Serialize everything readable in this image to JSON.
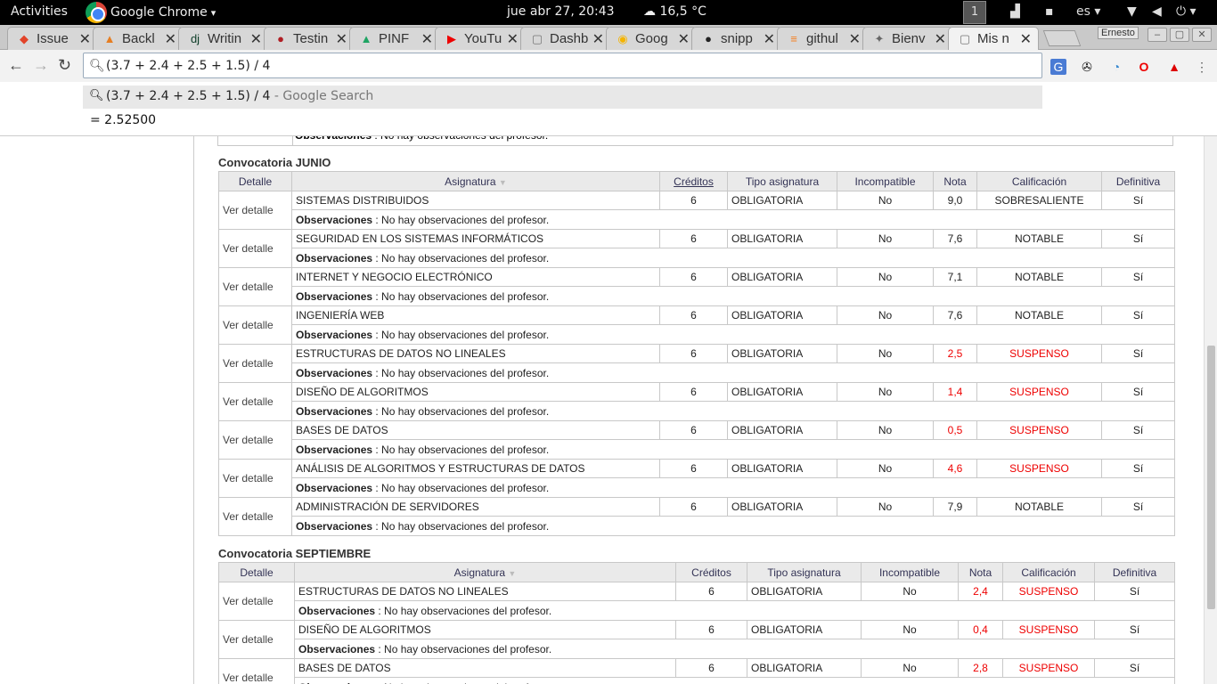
{
  "system": {
    "activities": "Activities",
    "app_name": "Google Chrome",
    "app_arrow": "▾",
    "clock": "jue abr 27, 20:43",
    "weather": "16,5 °C",
    "workspace": "1",
    "lang": "es ▾"
  },
  "tabs": [
    {
      "title": "Issue",
      "icon": "gitlab-icon",
      "color": "#e24329",
      "glyph": "◆"
    },
    {
      "title": "Backl",
      "icon": "backlog-icon",
      "color": "#e67e22",
      "glyph": "▲"
    },
    {
      "title": "Writin",
      "icon": "django-icon",
      "color": "#0c3c26",
      "glyph": "dj"
    },
    {
      "title": "Testin",
      "icon": "testing-icon",
      "color": "#b01e24",
      "glyph": "●"
    },
    {
      "title": "PINF",
      "icon": "google-drive-icon",
      "color": "#1fa463",
      "glyph": "▲"
    },
    {
      "title": "YouTu",
      "icon": "youtube-icon",
      "color": "#e00",
      "glyph": "▶"
    },
    {
      "title": "Dashb",
      "icon": "page-icon",
      "color": "#777",
      "glyph": "▢"
    },
    {
      "title": "Goog",
      "icon": "google-keep-icon",
      "color": "#f4b400",
      "glyph": "◉"
    },
    {
      "title": "snipp",
      "icon": "github-icon",
      "color": "#222",
      "glyph": "●"
    },
    {
      "title": "githul",
      "icon": "stackoverflow-icon",
      "color": "#f48024",
      "glyph": "≡"
    },
    {
      "title": "Bienv",
      "icon": "university-icon",
      "color": "#666",
      "glyph": "✦"
    },
    {
      "title": "Mis n",
      "icon": "page-icon",
      "color": "#777",
      "glyph": "▢"
    }
  ],
  "tab_close": "✕",
  "profile_name": "Ernesto",
  "omnibox": {
    "value": "(3.7 + 2.4 + 2.5 + 1.5) / 4",
    "suggestion_query": "(3.7 + 2.4 + 2.5 + 1.5) / 4",
    "suggestion_suffix": " - Google Search",
    "answer": "=  2.52500"
  },
  "top_obs": {
    "label": "Observaciones",
    "text": " : No hay observaciones del profesor."
  },
  "junio": {
    "title": "Convocatoria JUNIO",
    "headers": {
      "detalle": "Detalle",
      "asignatura": "Asignatura",
      "creditos": "Créditos",
      "tipo": "Tipo asignatura",
      "incompatible": "Incompatible",
      "nota": "Nota",
      "calificacion": "Calificación",
      "definitiva": "Definitiva"
    },
    "rows": [
      {
        "detalle": "Ver detalle",
        "asignatura": "SISTEMAS DISTRIBUIDOS",
        "creditos": "6",
        "tipo": "OBLIGATORIA",
        "incompatible": "No",
        "nota": "9,0",
        "calificacion": "SOBRESALIENTE",
        "definitiva": "Sí",
        "fail": false
      },
      {
        "detalle": "Ver detalle",
        "asignatura": "SEGURIDAD EN LOS SISTEMAS INFORMÁTICOS",
        "creditos": "6",
        "tipo": "OBLIGATORIA",
        "incompatible": "No",
        "nota": "7,6",
        "calificacion": "NOTABLE",
        "definitiva": "Sí",
        "fail": false
      },
      {
        "detalle": "Ver detalle",
        "asignatura": "INTERNET Y NEGOCIO ELECTRÓNICO",
        "creditos": "6",
        "tipo": "OBLIGATORIA",
        "incompatible": "No",
        "nota": "7,1",
        "calificacion": "NOTABLE",
        "definitiva": "Sí",
        "fail": false
      },
      {
        "detalle": "Ver detalle",
        "asignatura": "INGENIERÍA WEB",
        "creditos": "6",
        "tipo": "OBLIGATORIA",
        "incompatible": "No",
        "nota": "7,6",
        "calificacion": "NOTABLE",
        "definitiva": "Sí",
        "fail": false
      },
      {
        "detalle": "Ver detalle",
        "asignatura": "ESTRUCTURAS DE DATOS NO LINEALES",
        "creditos": "6",
        "tipo": "OBLIGATORIA",
        "incompatible": "No",
        "nota": "2,5",
        "calificacion": "SUSPENSO",
        "definitiva": "Sí",
        "fail": true
      },
      {
        "detalle": "Ver detalle",
        "asignatura": "DISEÑO DE ALGORITMOS",
        "creditos": "6",
        "tipo": "OBLIGATORIA",
        "incompatible": "No",
        "nota": "1,4",
        "calificacion": "SUSPENSO",
        "definitiva": "Sí",
        "fail": true
      },
      {
        "detalle": "Ver detalle",
        "asignatura": "BASES DE DATOS",
        "creditos": "6",
        "tipo": "OBLIGATORIA",
        "incompatible": "No",
        "nota": "0,5",
        "calificacion": "SUSPENSO",
        "definitiva": "Sí",
        "fail": true
      },
      {
        "detalle": "Ver detalle",
        "asignatura": "ANÁLISIS DE ALGORITMOS Y ESTRUCTURAS DE DATOS",
        "creditos": "6",
        "tipo": "OBLIGATORIA",
        "incompatible": "No",
        "nota": "4,6",
        "calificacion": "SUSPENSO",
        "definitiva": "Sí",
        "fail": true
      },
      {
        "detalle": "Ver detalle",
        "asignatura": "ADMINISTRACIÓN DE SERVIDORES",
        "creditos": "6",
        "tipo": "OBLIGATORIA",
        "incompatible": "No",
        "nota": "7,9",
        "calificacion": "NOTABLE",
        "definitiva": "Sí",
        "fail": false
      }
    ]
  },
  "septiembre": {
    "title": "Convocatoria SEPTIEMBRE",
    "headers": {
      "detalle": "Detalle",
      "asignatura": "Asignatura",
      "creditos": "Créditos",
      "tipo": "Tipo asignatura",
      "incompatible": "Incompatible",
      "nota": "Nota",
      "calificacion": "Calificación",
      "definitiva": "Definitiva"
    },
    "rows": [
      {
        "detalle": "Ver detalle",
        "asignatura": "ESTRUCTURAS DE DATOS NO LINEALES",
        "creditos": "6",
        "tipo": "OBLIGATORIA",
        "incompatible": "No",
        "nota": "2,4",
        "calificacion": "SUSPENSO",
        "definitiva": "Sí",
        "fail": true
      },
      {
        "detalle": "Ver detalle",
        "asignatura": "DISEÑO DE ALGORITMOS",
        "creditos": "6",
        "tipo": "OBLIGATORIA",
        "incompatible": "No",
        "nota": "0,4",
        "calificacion": "SUSPENSO",
        "definitiva": "Sí",
        "fail": true
      },
      {
        "detalle": "Ver detalle",
        "asignatura": "BASES DE DATOS",
        "creditos": "6",
        "tipo": "OBLIGATORIA",
        "incompatible": "No",
        "nota": "2,8",
        "calificacion": "SUSPENSO",
        "definitiva": "Sí",
        "fail": true
      }
    ]
  },
  "obs": {
    "label": "Observaciones",
    "text": " : No hay observaciones del profesor."
  },
  "colors": {
    "fail": "#e00000",
    "header_bg": "#eaeaea",
    "tab_active": "#f2f2f2"
  }
}
